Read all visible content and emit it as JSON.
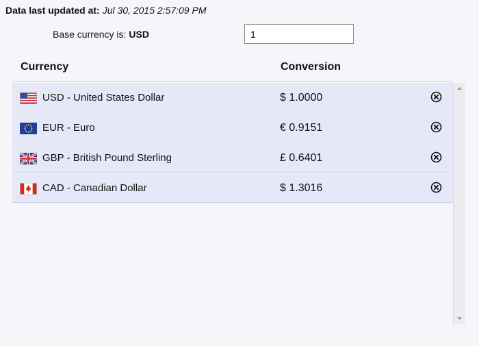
{
  "header": {
    "updated_label": "Data last updated at:",
    "updated_value": "Jul 30, 2015 2:57:09 PM",
    "base_label": "Base currency is:",
    "base_currency": "USD",
    "amount_value": "1"
  },
  "table": {
    "columns": [
      "Currency",
      "Conversion"
    ],
    "rows": [
      {
        "flag": "us-flag-icon",
        "name": "USD - United States Dollar",
        "rate": "$ 1.0000"
      },
      {
        "flag": "eu-flag-icon",
        "name": "EUR - Euro",
        "rate": "€ 0.9151"
      },
      {
        "flag": "gb-flag-icon",
        "name": "GBP - British Pound Sterling",
        "rate": "£ 0.6401"
      },
      {
        "flag": "ca-flag-icon",
        "name": "CAD - Canadian Dollar",
        "rate": "$ 1.3016"
      }
    ],
    "remove_icon": "circle-x-icon"
  },
  "colors": {
    "background": "#f6f6fa",
    "row_background": "#e4e8f7",
    "row_border": "#cdd2e6",
    "text": "#111111"
  }
}
